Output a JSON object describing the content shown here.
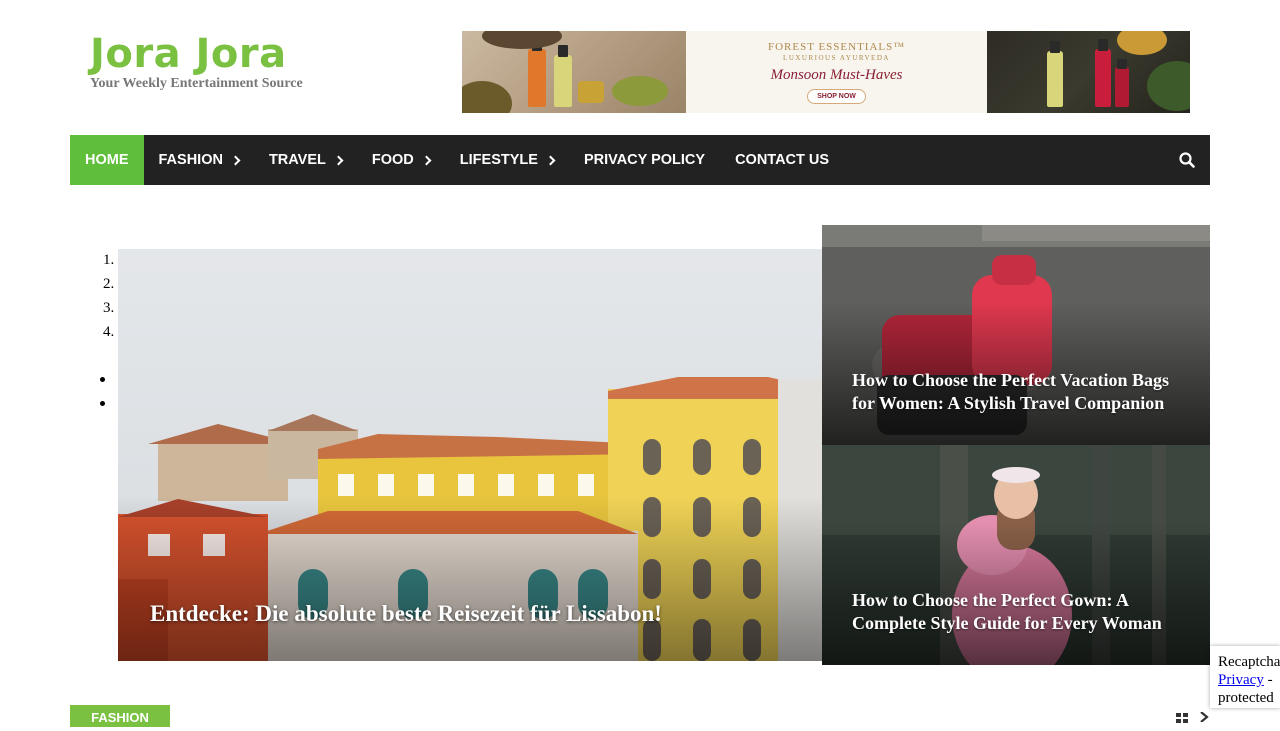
{
  "site": {
    "title": "Jora Jora",
    "tagline": "Your Weekly Entertainment Source"
  },
  "banner": {
    "brand": "FOREST ESSENTIALS™",
    "brand_sub": "LUXURIOUS AYURVEDA",
    "headline": "Monsoon Must-Haves",
    "cta": "SHOP NOW"
  },
  "nav": {
    "items": [
      {
        "label": "HOME",
        "active": true,
        "submenu": false
      },
      {
        "label": "FASHION",
        "submenu": true
      },
      {
        "label": "TRAVEL",
        "submenu": true
      },
      {
        "label": "FOOD",
        "submenu": true
      },
      {
        "label": "LIFESTYLE",
        "submenu": true
      },
      {
        "label": "PRIVACY POLICY",
        "submenu": false
      },
      {
        "label": "CONTACT US",
        "submenu": false
      }
    ],
    "search_icon": "search-icon"
  },
  "slider": {
    "indicators": [
      "1.",
      "2.",
      "3.",
      "4."
    ],
    "main_post": {
      "title": "Entdecke: Die absolute beste Reisezeit für Lissabon!"
    }
  },
  "side_posts": [
    {
      "title": "How to Choose the Perfect Vacation Bags for Women: A Stylish Travel Companion"
    },
    {
      "title": "How to Choose the Perfect Gown: A Complete Style Guide for Every Woman"
    }
  ],
  "section": {
    "category": "FASHION"
  },
  "recaptcha": {
    "label": "Recaptcha",
    "privacy": "Privacy",
    "separator": " - ",
    "protected": "protected"
  },
  "colors": {
    "accent": "#7ac142",
    "nav_bg": "#222222",
    "nav_active": "#5fbf3a"
  }
}
